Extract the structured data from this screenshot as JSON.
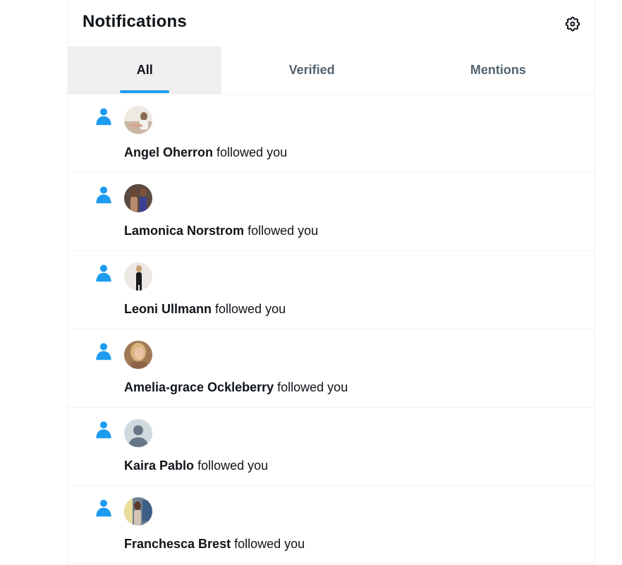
{
  "header": {
    "title": "Notifications",
    "settings_icon": "gear-icon"
  },
  "tabs": [
    {
      "label": "All",
      "active": true
    },
    {
      "label": "Verified",
      "active": false
    },
    {
      "label": "Mentions",
      "active": false
    }
  ],
  "colors": {
    "accent": "#1d9bf0",
    "text": "#0f1419",
    "secondary_text": "#536471",
    "active_tab_bg": "#efefef"
  },
  "notifications": [
    {
      "icon": "person-icon",
      "avatar": "user-avatar",
      "name": "Angel Oherron",
      "action": "followed you"
    },
    {
      "icon": "person-icon",
      "avatar": "user-avatar",
      "name": "Lamonica Norstrom",
      "action": "followed you"
    },
    {
      "icon": "person-icon",
      "avatar": "user-avatar",
      "name": "Leoni Ullmann",
      "action": "followed you"
    },
    {
      "icon": "person-icon",
      "avatar": "user-avatar",
      "name": "Amelia-grace Ockleberry",
      "action": "followed you"
    },
    {
      "icon": "person-icon",
      "avatar": "default-avatar",
      "name": "Kaira Pablo",
      "action": "followed you"
    },
    {
      "icon": "person-icon",
      "avatar": "user-avatar",
      "name": "Franchesca Brest",
      "action": "followed you"
    }
  ]
}
